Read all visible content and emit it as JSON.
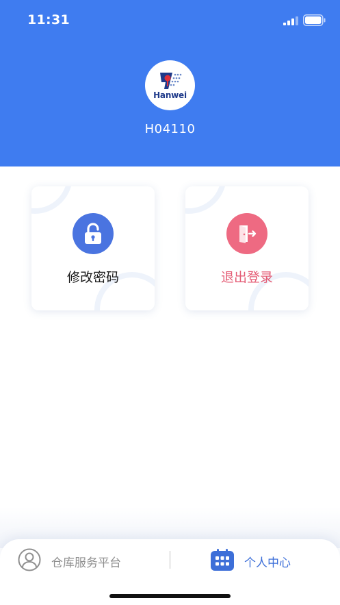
{
  "status_bar": {
    "time": "11:31"
  },
  "header": {
    "logo_text": "Hanwei",
    "username": "H04110",
    "color": "#3f7cf0"
  },
  "actions": [
    {
      "label": "修改密码",
      "icon": "unlock-icon",
      "color": "#4a74e0"
    },
    {
      "label": "退出登录",
      "icon": "logout-door-icon",
      "color": "#ee6a82"
    }
  ],
  "tabbar": {
    "tabs": [
      {
        "label": "仓库服务平台",
        "icon": "user-circle-icon",
        "active": false
      },
      {
        "label": "个人中心",
        "icon": "grid-icon",
        "active": true
      }
    ],
    "active_color": "#3d6fd8",
    "inactive_color": "#8f8f8f"
  }
}
